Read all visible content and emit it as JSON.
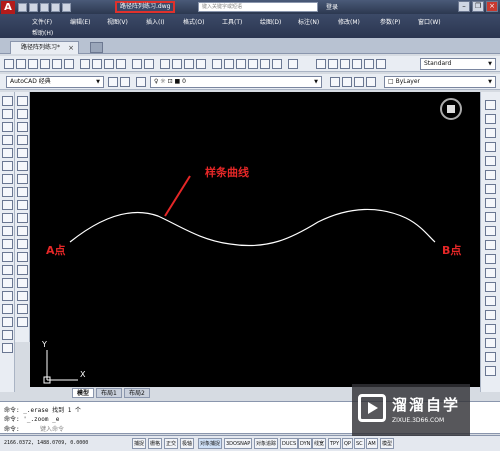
{
  "title_bar": {
    "app_logo": "A",
    "doc_title": "路径阵列练习.dwg",
    "search_placeholder": "键入关键字或短语",
    "login": "登录",
    "help": "?"
  },
  "menu": {
    "row1": [
      "文件(F)",
      "编辑(E)",
      "视图(V)",
      "插入(I)",
      "格式(O)",
      "工具(T)",
      "绘图(D)",
      "标注(N)",
      "修改(M)",
      "参数(P)",
      "窗口(W)"
    ],
    "row2": [
      "帮助(H)"
    ]
  },
  "doc_tabs": {
    "active": "路径阵列练习*",
    "close": "×"
  },
  "toolbar": {
    "text_style_combo": "Standard",
    "workspace_combo": "AutoCAD 经典",
    "layer_combo": "0",
    "color_combo": "ByLayer"
  },
  "canvas": {
    "spline_label": "样条曲线",
    "point_a": "A点",
    "point_b": "B点",
    "ucs_y": "Y",
    "ucs_x": "X"
  },
  "layout_tabs": [
    "模型",
    "布局1",
    "布局2"
  ],
  "command": {
    "line1": "命令: _.erase 找到 1 个",
    "line2": "命令: '_.zoom _e",
    "prompt_prefix": "命令:",
    "prompt_placeholder": "键入命令"
  },
  "status_bar": {
    "coords": "2166.0372, 1488.0709, 0.0000",
    "toggles": [
      "捕捉",
      "栅格",
      "正交",
      "极轴",
      "对象捕捉",
      "3DOSNAP",
      "对象追踪",
      "DUCS",
      "DYN",
      "线宽",
      "TPY",
      "QP",
      "SC",
      "AM"
    ],
    "model": "模型"
  },
  "watermark": {
    "title": "溜溜自学",
    "url": "ZIXUE.3D66.COM"
  },
  "colors": {
    "canvas_bg": "#000000",
    "label_red": "#e52727",
    "accent_title_border": "#e0312c"
  }
}
